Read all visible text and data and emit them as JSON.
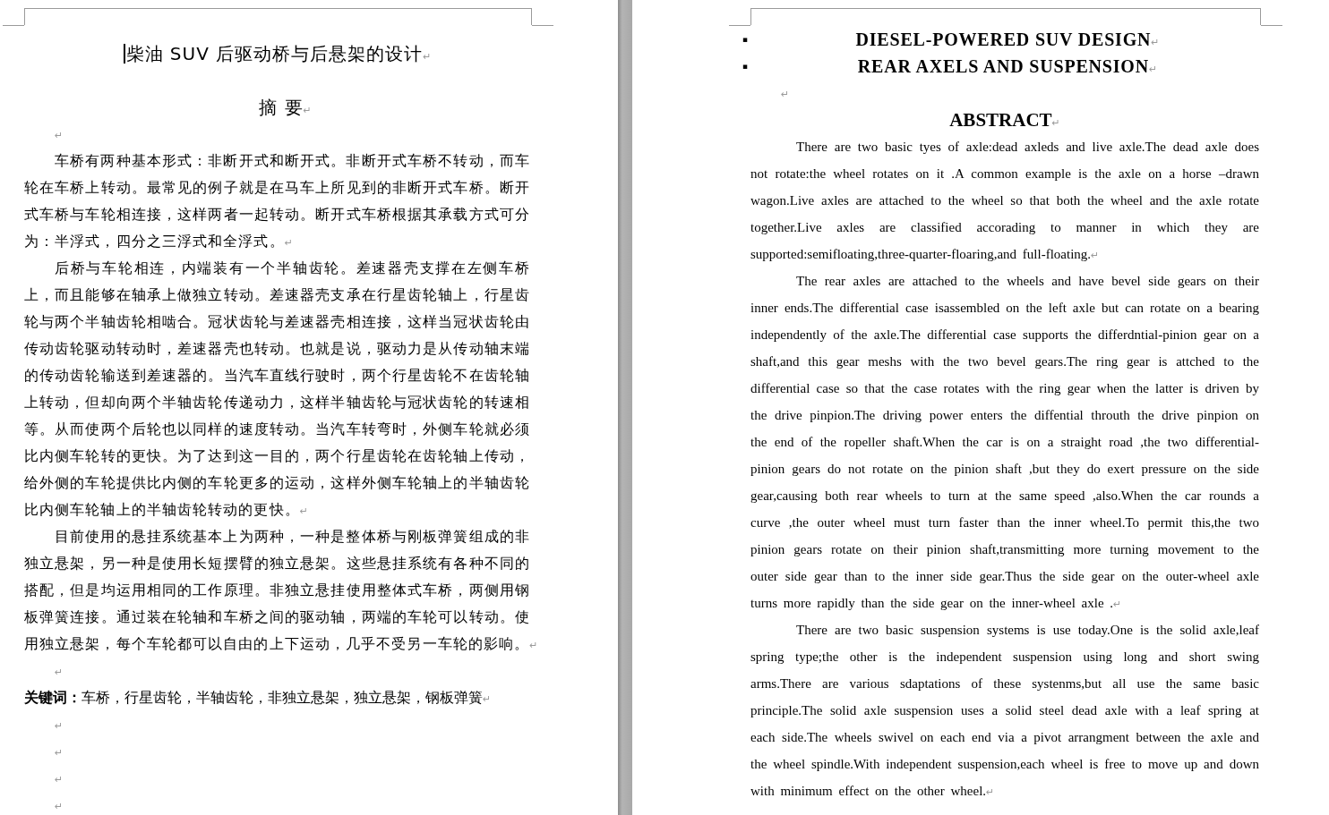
{
  "pages": [
    {
      "kind": "chinese",
      "blocks": [
        {
          "kind": "title",
          "text": "柴油 SUV 后驱动桥与后悬架的设计",
          "mark": "↵",
          "cursor": true
        },
        {
          "kind": "heading",
          "text": "摘 要",
          "mark": "↵"
        },
        {
          "kind": "empty",
          "mark": "↵"
        },
        {
          "kind": "body",
          "text": "车桥有两种基本形式：非断开式和断开式。非断开式车桥不转动，而车轮在车桥上转动。最常见的例子就是在马车上所见到的非断开式车桥。断开式车桥与车轮相连接，这样两者一起转动。断开式车桥根据其承载方式可分为：半浮式，四分之三浮式和全浮式。",
          "mark": "↵"
        },
        {
          "kind": "body",
          "text": "后桥与车轮相连，内端装有一个半轴齿轮。差速器壳支撑在左侧车桥上，而且能够在轴承上做独立转动。差速器壳支承在行星齿轮轴上，行星齿轮与两个半轴齿轮相啮合。冠状齿轮与差速器壳相连接，这样当冠状齿轮由传动齿轮驱动转动时，差速器壳也转动。也就是说，驱动力是从传动轴末端的传动齿轮输送到差速器的。当汽车直线行驶时，两个行星齿轮不在齿轮轴上转动，但却向两个半轴齿轮传递动力，这样半轴齿轮与冠状齿轮的转速相等。从而使两个后轮也以同样的速度转动。当汽车转弯时，外侧车轮就必须比内侧车轮转的更快。为了达到这一目的，两个行星齿轮在齿轮轴上传动，给外侧的车轮提供比内侧的车轮更多的运动，这样外侧车轮轴上的半轴齿轮比内侧车轮轴上的半轴齿轮转动的更快。",
          "mark": "↵"
        },
        {
          "kind": "body",
          "text": "目前使用的悬挂系统基本上为两种，一种是整体桥与刚板弹簧组成的非独立悬架，另一种是使用长短摆臂的独立悬架。这些悬挂系统有各种不同的搭配，但是均运用相同的工作原理。非独立悬挂使用整体式车桥，两侧用钢板弹簧连接。通过装在轮轴和车桥之间的驱动轴，两端的车轮可以转动。使用独立悬架，每个车轮都可以自由的上下运动，几乎不受另一车轮的影响。",
          "mark": "↵"
        },
        {
          "kind": "empty",
          "mark": "↵"
        },
        {
          "kind": "keywords",
          "text": "**关键词：**车桥，行星齿轮，半轴齿轮，非独立悬架，独立悬架，钢板弹簧",
          "mark": "↵"
        },
        {
          "kind": "empty",
          "mark": "↵"
        },
        {
          "kind": "empty",
          "mark": "↵"
        },
        {
          "kind": "empty",
          "mark": "↵"
        },
        {
          "kind": "empty",
          "mark": "↵"
        }
      ]
    },
    {
      "kind": "english",
      "blocks": [
        {
          "kind": "bullet_title",
          "bullet": "▪",
          "text": "DIESEL-POWERED SUV DESIGN",
          "mark": "↵"
        },
        {
          "kind": "bullet_title",
          "bullet": "▪",
          "text": "REAR AXELS AND SUSPENSION",
          "mark": "↵"
        },
        {
          "kind": "empty",
          "mark": "↵"
        },
        {
          "kind": "heading",
          "text": "ABSTRACT",
          "mark": "↵"
        },
        {
          "kind": "body",
          "text": "There are two basic tyes of axle:dead axleds and live axle.The dead axle does not rotate:the wheel rotates on it .A common example is the axle on a horse –drawn wagon.Live axles are attached to the wheel so that both the wheel and the axle rotate together.Live axles are classified accorading to manner in which they are supported:semifloating,three-quarter-floaring,and full-floating.",
          "mark": "↵"
        },
        {
          "kind": "body",
          "text": "The rear axles are attached to the wheels and have bevel side gears on their inner ends.The differential case isassembled on the left axle but can rotate on a bearing independently of the axle.The differential case supports the differdntial-pinion gear on a shaft,and this gear meshs with the two bevel gears.The ring gear is attched to the differential case so that the case rotates with the ring gear when the latter is driven by the drive pinpion.The driving power enters the diffential throuth the drive pinpion on the end of the ropeller shaft.When the car is on a straight road ,the two differential-pinion gears do not rotate on the pinion shaft ,but they do exert pressure on the side gear,causing both rear wheels to turn at the same speed ,also.When the car rounds a curve ,the outer wheel must turn faster than the inner wheel.To permit this,the two pinion gears rotate on their pinion shaft,transmitting more turning movement to the outer side gear than to the inner side gear.Thus the side gear on the outer-wheel axle turns more rapidly than the side gear on the inner-wheel axle .",
          "mark": "↵"
        },
        {
          "kind": "body",
          "text": "There are two basic suspension systems is use today.One is the solid axle,leaf spring type;the other is the independent suspension using long and short swing arms.There are various sdaptations of these systenms,but all use the same basic principle.The solid axle suspension uses a solid steel dead axle with a leaf spring at each side.The wheels swivel on each end via a pivot arrangment between the axle and the wheel spindle.With independent suspension,each wheel is free to move up and down with minimum effect on the other wheel.",
          "mark": "↵"
        }
      ]
    }
  ]
}
